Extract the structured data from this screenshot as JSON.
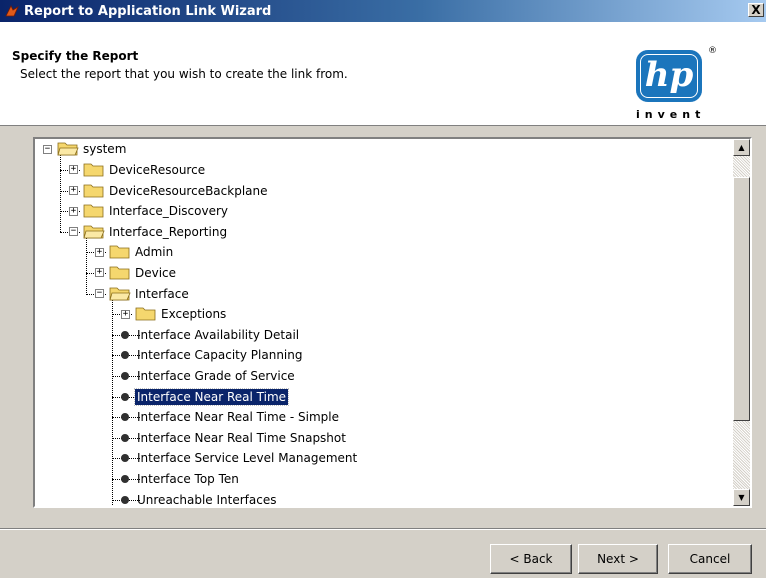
{
  "window": {
    "title": "Report to Application Link Wizard",
    "close_glyph": "X",
    "icon": "wizard-app-icon"
  },
  "header": {
    "title": "Specify the Report",
    "subtitle": "Select the report that you wish to create the link from.",
    "logo": {
      "mark": "hp",
      "registered": "®",
      "tagline": "invent",
      "color": "#1b75bc"
    }
  },
  "tree": {
    "items": [
      {
        "label": "system",
        "level": 0,
        "type": "folder",
        "expanded": true
      },
      {
        "label": "DeviceResource",
        "level": 1,
        "type": "folder",
        "expanded": false
      },
      {
        "label": "DeviceResourceBackplane",
        "level": 1,
        "type": "folder",
        "expanded": false
      },
      {
        "label": "Interface_Discovery",
        "level": 1,
        "type": "folder",
        "expanded": false
      },
      {
        "label": "Interface_Reporting",
        "level": 1,
        "type": "folder",
        "expanded": true
      },
      {
        "label": "Admin",
        "level": 2,
        "type": "folder",
        "expanded": false
      },
      {
        "label": "Device",
        "level": 2,
        "type": "folder",
        "expanded": false
      },
      {
        "label": "Interface",
        "level": 2,
        "type": "folder",
        "expanded": true
      },
      {
        "label": "Exceptions",
        "level": 3,
        "type": "folder",
        "expanded": false
      },
      {
        "label": "Interface Availability Detail",
        "level": 3,
        "type": "report"
      },
      {
        "label": "Interface Capacity Planning",
        "level": 3,
        "type": "report"
      },
      {
        "label": "Interface Grade of Service",
        "level": 3,
        "type": "report"
      },
      {
        "label": "Interface Near Real Time",
        "level": 3,
        "type": "report",
        "selected": true
      },
      {
        "label": "Interface Near Real Time - Simple",
        "level": 3,
        "type": "report"
      },
      {
        "label": "Interface Near Real Time Snapshot",
        "level": 3,
        "type": "report"
      },
      {
        "label": "Interface Service Level Management",
        "level": 3,
        "type": "report"
      },
      {
        "label": "Interface Top Ten",
        "level": 3,
        "type": "report"
      },
      {
        "label": "Unreachable Interfaces",
        "level": 3,
        "type": "report"
      }
    ],
    "selection_color": "#0a246a",
    "scroll_up_glyph": "▲",
    "scroll_down_glyph": "▼"
  },
  "buttons": {
    "back": "< Back",
    "next": "Next >",
    "cancel": "Cancel"
  }
}
